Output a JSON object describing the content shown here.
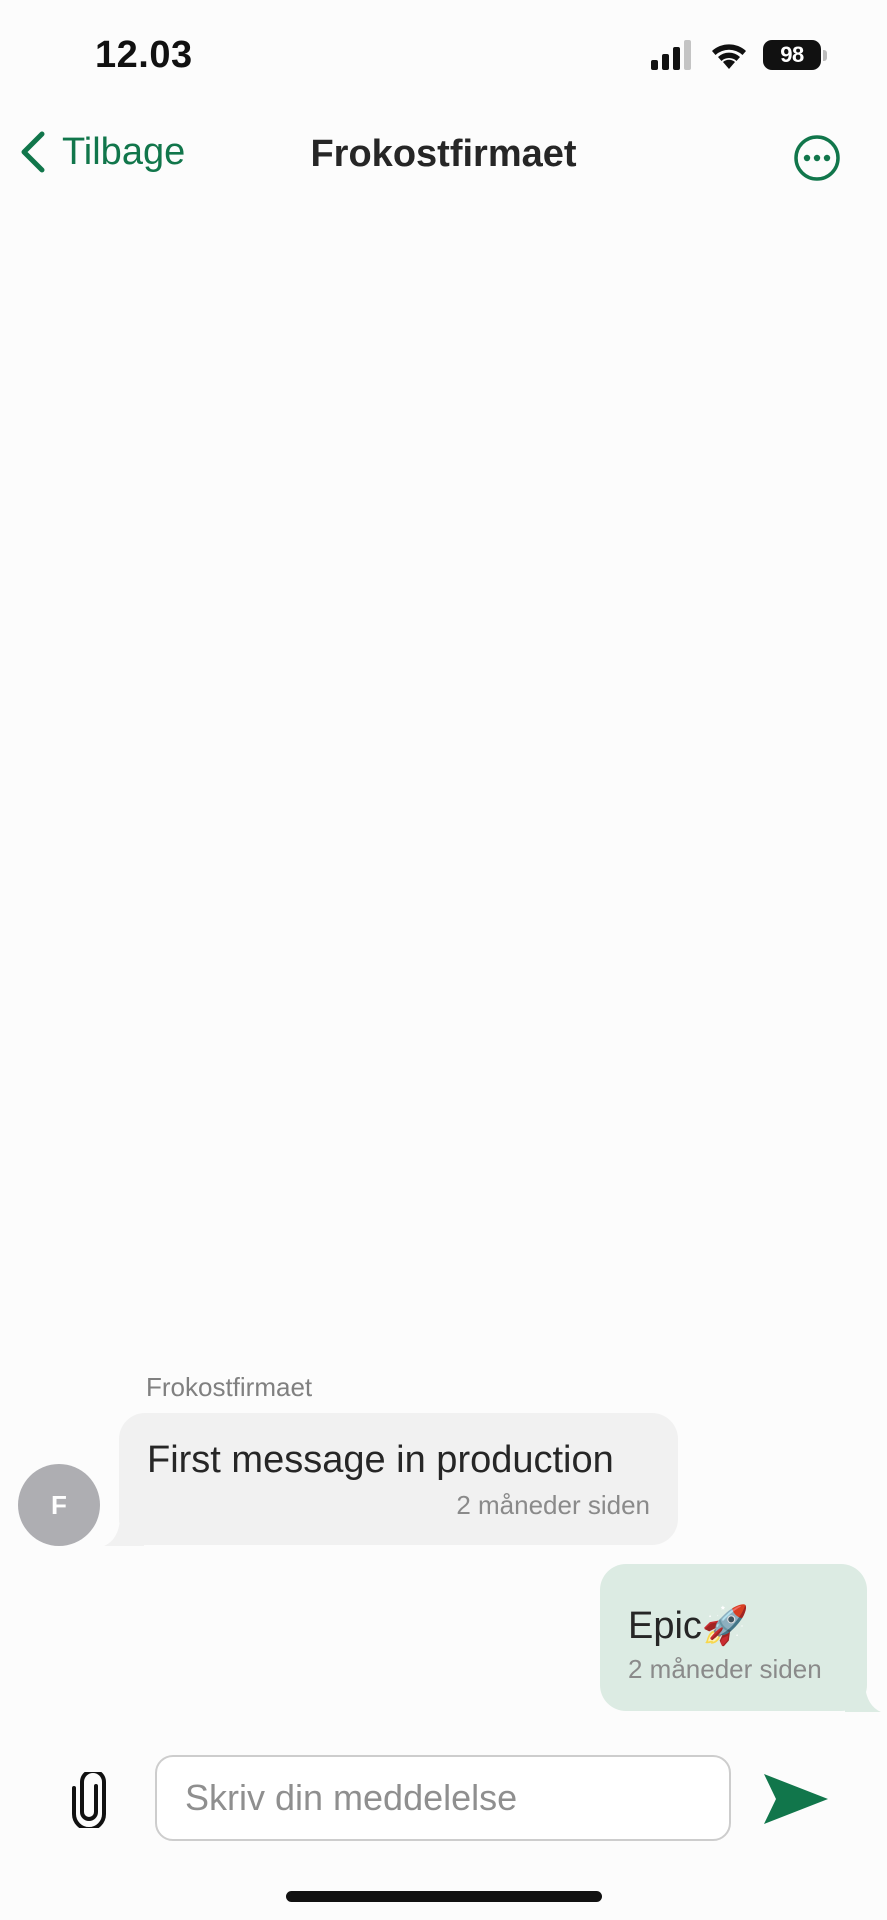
{
  "status_bar": {
    "time": "12.03",
    "battery_level": "98",
    "signal_bars_active": 3,
    "signal_bars_total": 4
  },
  "nav": {
    "back_label": "Tilbage",
    "title": "Frokostfirmaet"
  },
  "conversation": {
    "incoming": {
      "sender": "Frokostfirmaet",
      "avatar_initial": "F",
      "text": "First message in production",
      "time": "2 måneder siden"
    },
    "outgoing": {
      "text": "Epic🚀",
      "time": "2 måneder siden"
    }
  },
  "composer": {
    "placeholder": "Skriv din meddelelse",
    "value": ""
  },
  "colors": {
    "accent": "#11764b",
    "incoming_bubble": "#f1f1f1",
    "outgoing_bubble": "#dcebe3"
  },
  "icons": [
    "signal-icon",
    "wifi-icon",
    "battery-icon",
    "chevron-left-icon",
    "more-options-icon",
    "paperclip-icon",
    "send-icon"
  ]
}
